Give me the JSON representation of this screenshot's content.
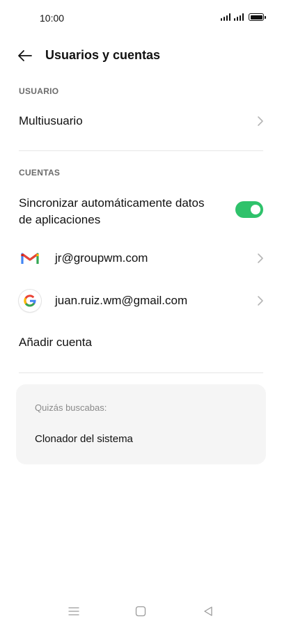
{
  "status_bar": {
    "time": "10:00"
  },
  "header": {
    "title": "Usuarios y cuentas"
  },
  "sections": {
    "user_header": "USUARIO",
    "accounts_header": "CUENTAS"
  },
  "rows": {
    "multiuser": "Multiusuario",
    "auto_sync_line1": "Sincronizar automáticamente datos",
    "auto_sync_line2": "de aplicaciones",
    "auto_sync_enabled": true,
    "add_account": "Añadir cuenta"
  },
  "accounts": [
    {
      "email": "jr@groupwm.com",
      "icon": "gmail-icon"
    },
    {
      "email": "juan.ruiz.wm@gmail.com",
      "icon": "google-icon"
    }
  ],
  "suggestions": {
    "header": "Quizás buscabas:",
    "item": "Clonador del sistema"
  },
  "nav": {
    "items": [
      "menu-icon",
      "home-icon",
      "back-triangle-icon"
    ]
  },
  "colors": {
    "toggle_on": "#2fc26b",
    "card_bg": "#f5f5f5",
    "section_header": "#6b6b6b"
  }
}
